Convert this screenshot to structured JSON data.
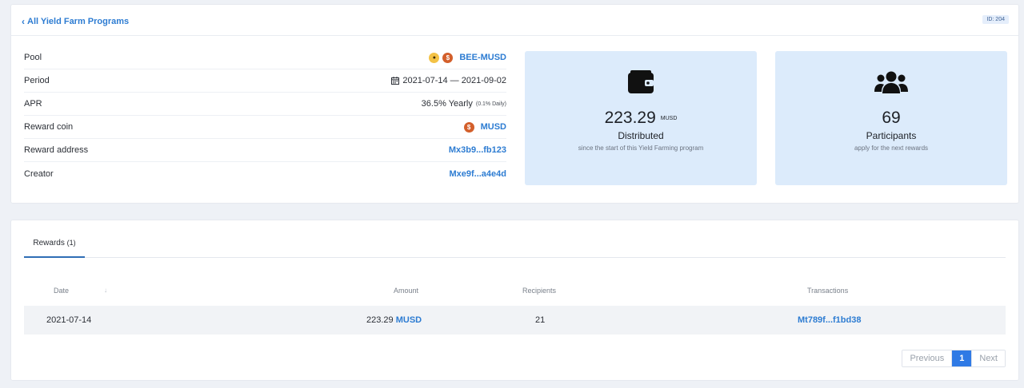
{
  "header": {
    "back_label": "All Yield Farm Programs",
    "id_badge": "ID: 204"
  },
  "details": {
    "pool_label": "Pool",
    "pool_value": "BEE-MUSD",
    "period_label": "Period",
    "period_value": "2021-07-14 — 2021-09-02",
    "apr_label": "APR",
    "apr_value": "36.5% Yearly",
    "apr_daily": "(0.1% Daily)",
    "reward_coin_label": "Reward coin",
    "reward_coin_value": "MUSD",
    "reward_address_label": "Reward address",
    "reward_address_value": "Mx3b9...fb123",
    "creator_label": "Creator",
    "creator_value": "Mxe9f...a4e4d"
  },
  "stats": {
    "distributed_number": "223.29",
    "distributed_unit": "MUSD",
    "distributed_title": "Distributed",
    "distributed_sub": "since the start of this Yield Farming program",
    "participants_number": "69",
    "participants_title": "Participants",
    "participants_sub": "apply for the next rewards"
  },
  "rewards": {
    "tab_label": "Rewards",
    "tab_count": "(1)",
    "columns": {
      "date": "Date",
      "amount": "Amount",
      "recipients": "Recipients",
      "transactions": "Transactions"
    },
    "sort_indicator": "↓",
    "rows": [
      {
        "date": "2021-07-14",
        "amount": "223.29",
        "amount_coin": "MUSD",
        "recipients": "21",
        "transaction": "Mt789f...f1bd38"
      }
    ]
  },
  "pagination": {
    "previous": "Previous",
    "current": "1",
    "next": "Next"
  },
  "icons": {
    "coin_glyph": "$",
    "bee_glyph": "🐝"
  },
  "colors": {
    "accent": "#2d7cd2",
    "stat_bg": "#dcebfb",
    "coin": "#d35f2b",
    "active_page": "#2f7ae5"
  }
}
